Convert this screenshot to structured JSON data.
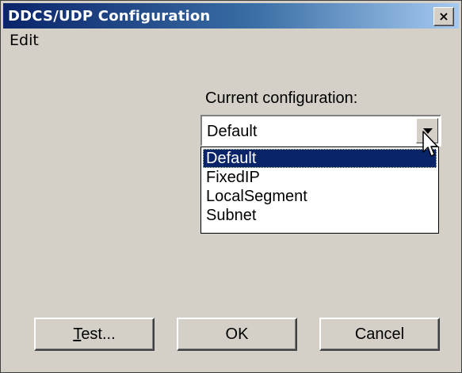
{
  "window": {
    "title": "DDCS/UDP Configuration",
    "close_glyph": "✕"
  },
  "menu": {
    "items": [
      {
        "label": "Edit"
      }
    ]
  },
  "config": {
    "label": "Current configuration:",
    "selected": "Default",
    "options": [
      {
        "label": "Default",
        "selected": true
      },
      {
        "label": "FixedIP",
        "selected": false
      },
      {
        "label": "LocalSegment",
        "selected": false
      },
      {
        "label": "Subnet",
        "selected": false
      }
    ]
  },
  "buttons": {
    "test": {
      "accel": "T",
      "rest": "est..."
    },
    "ok": {
      "label": "OK"
    },
    "cancel": {
      "label": "Cancel"
    }
  },
  "colors": {
    "title_gradient_start": "#0a246a",
    "title_gradient_end": "#a6caf0",
    "face": "#d4d0c8",
    "selection": "#0a246a"
  }
}
